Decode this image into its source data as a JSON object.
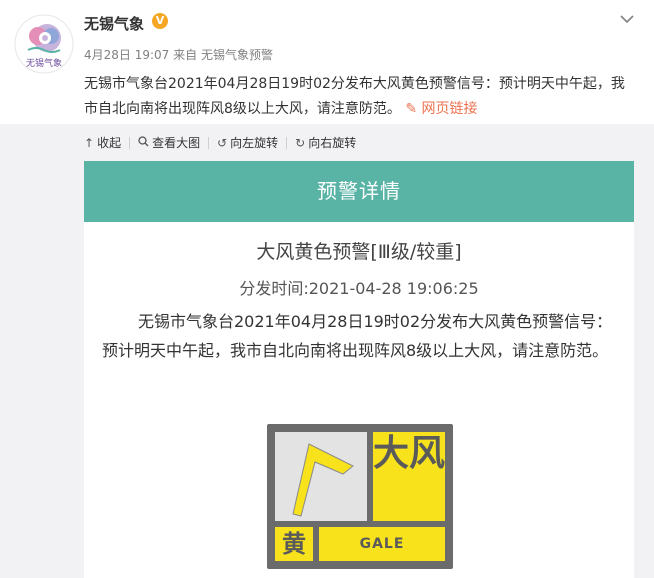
{
  "account": {
    "name": "无锡气象",
    "verified_badge": "V",
    "avatar_caption": "无锡气象",
    "more_icon": "chevron-down-icon"
  },
  "post": {
    "date": "4月28日 19:07",
    "source_prefix": "来自",
    "source": "无锡气象预警",
    "text": "无锡市气象台2021年04月28日19时02分发布大风黄色预警信号：预计明天中午起，我市自北向南将出现阵风8级以上大风，请注意防范。",
    "link_label": "网页链接"
  },
  "toolbar": {
    "collapse": "收起",
    "view_large": "查看大图",
    "rotate_left": "向左旋转",
    "rotate_right": "向右旋转"
  },
  "card": {
    "header": "预警详情",
    "title": "大风黄色预警[Ⅲ级/较重]",
    "issue_time": "分发时间:2021-04-28  19:06:25",
    "body": "无锡市气象台2021年04月28日19时02分发布大风黄色预警信号：预计明天中午起，我市自北向南将出现阵风8级以上大风，请注意防范。",
    "signal": {
      "big_char": "大风",
      "level_char": "黄",
      "english": "GALE",
      "colors": {
        "yellow": "#f7e21b",
        "frame": "#6b6b6b",
        "flag_bg": "#e3e3e3"
      }
    }
  },
  "colors": {
    "accent": "#5ab4a6",
    "link": "#eb7350",
    "meta": "#808080"
  }
}
